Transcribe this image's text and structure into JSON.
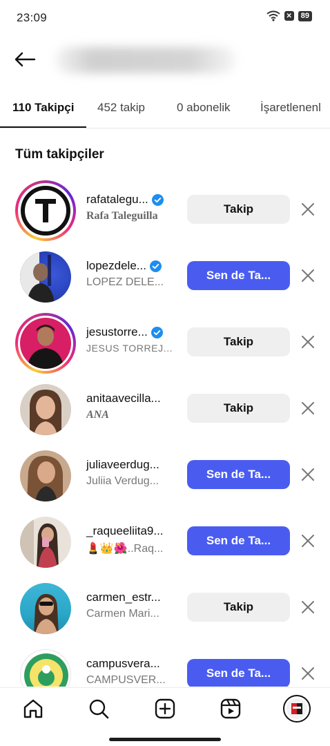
{
  "status_bar": {
    "time": "23:09",
    "battery": "89",
    "icons": [
      "wifi-icon",
      "no-sim-icon",
      "battery-icon"
    ]
  },
  "header": {
    "back_icon": "arrow-left-icon"
  },
  "tabs": [
    {
      "label": "110 Takipçi",
      "active": true
    },
    {
      "label": "452 takip",
      "active": false
    },
    {
      "label": "0 abonelik",
      "active": false
    },
    {
      "label": "İşaretlenenl",
      "active": false
    }
  ],
  "section_title": "Tüm takipçiler",
  "accent_color": "#4a5cf0",
  "verified_color": "#1d8ef0",
  "followers": [
    {
      "handle": "rafatalegu...",
      "verified": true,
      "name": "Rafa Taleguilla",
      "button": "Takip",
      "type": "follow"
    },
    {
      "handle": "lopezdele...",
      "verified": true,
      "name": "LOPEZ DELE...",
      "button": "Sen de Ta...",
      "type": "followback"
    },
    {
      "handle": "jesustorre...",
      "verified": true,
      "name": "JESUS TORREJ...",
      "button": "Takip",
      "type": "follow"
    },
    {
      "handle": "anitaavecilla...",
      "verified": false,
      "name": "ANA",
      "button": "Takip",
      "type": "follow"
    },
    {
      "handle": "juliaveerdug...",
      "verified": false,
      "name": "Juliia Verdug...",
      "button": "Sen de Ta...",
      "type": "followback"
    },
    {
      "handle": "_raqueeliita9...",
      "verified": false,
      "name": "💄👑🌺..Raq...",
      "button": "Sen de Ta...",
      "type": "followback"
    },
    {
      "handle": "carmen_estr...",
      "verified": false,
      "name": "Carmen Mari...",
      "button": "Takip",
      "type": "follow"
    },
    {
      "handle": "campusvera...",
      "verified": false,
      "name": "CAMPUSVER...",
      "button": "Sen de Ta...",
      "type": "followback"
    }
  ],
  "bottom_nav": [
    "home-icon",
    "search-icon",
    "create-icon",
    "reels-icon",
    "profile-avatar"
  ]
}
